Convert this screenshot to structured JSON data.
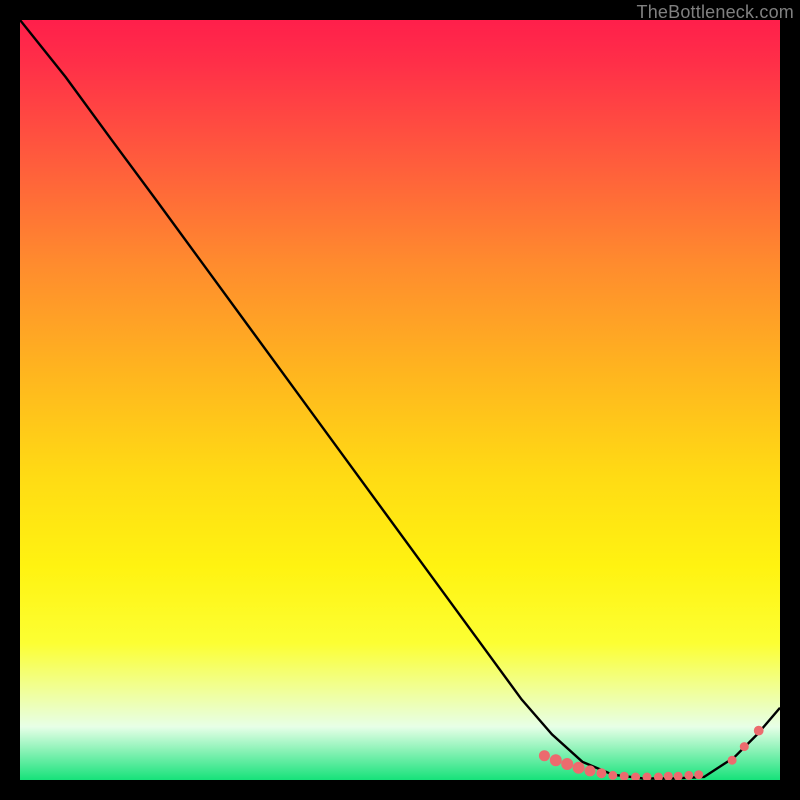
{
  "watermark": "TheBottleneck.com",
  "colors": {
    "curve": "#000000",
    "marker_fill": "#ec6b6e",
    "marker_stroke": "#ec6b6e",
    "background": "#000000"
  },
  "chart_data": {
    "type": "line",
    "title": "",
    "xlabel": "",
    "ylabel": "",
    "xlim": [
      0,
      100
    ],
    "ylim": [
      0,
      100
    ],
    "grid": false,
    "legend": false,
    "series": [
      {
        "name": "bottleneck-curve",
        "x": [
          0,
          6,
          12,
          18,
          24,
          30,
          36,
          42,
          48,
          54,
          60,
          66,
          70,
          74,
          78,
          82,
          86,
          90,
          94,
          97,
          100
        ],
        "y": [
          100,
          92.5,
          84.3,
          76.2,
          68.0,
          59.8,
          51.6,
          43.4,
          35.2,
          27.0,
          18.8,
          10.6,
          6.0,
          2.4,
          0.7,
          0.2,
          0.2,
          0.4,
          3.0,
          6.0,
          9.5
        ]
      }
    ],
    "markers": {
      "flat_cluster": {
        "x": [
          69,
          70.5,
          72,
          73.5,
          75,
          76.5,
          78,
          79.5,
          81,
          82.5,
          84,
          85.3,
          86.6,
          88,
          89.3
        ],
        "y": [
          3.2,
          2.6,
          2.1,
          1.6,
          1.2,
          0.9,
          0.6,
          0.5,
          0.4,
          0.4,
          0.4,
          0.5,
          0.5,
          0.6,
          0.7
        ],
        "r": [
          5,
          5.5,
          5.5,
          5.5,
          5,
          4.5,
          4,
          4,
          4,
          4,
          4,
          4,
          4,
          4,
          4
        ]
      },
      "rising_points": {
        "x": [
          93.7,
          95.3,
          97.2
        ],
        "y": [
          2.6,
          4.4,
          6.5
        ],
        "r": [
          4,
          4,
          4.4
        ]
      }
    }
  }
}
